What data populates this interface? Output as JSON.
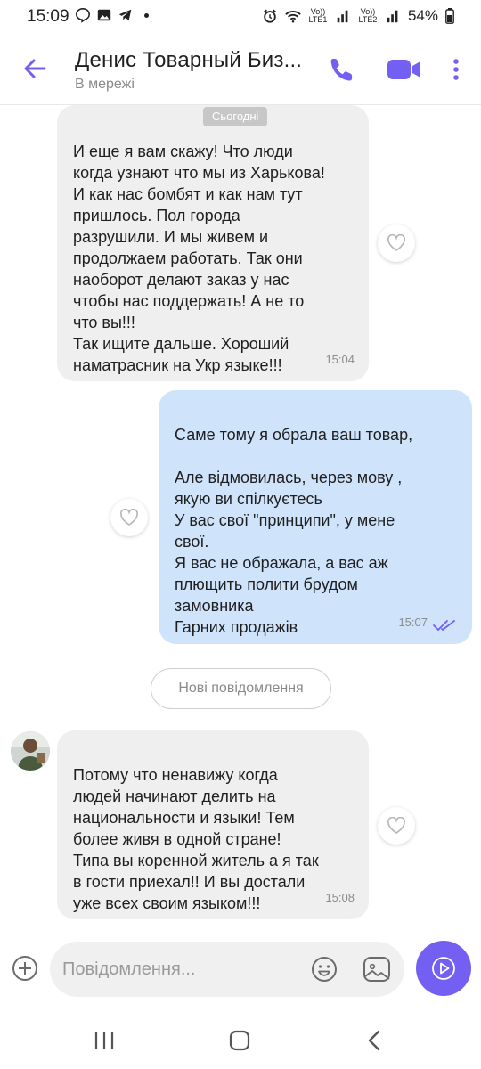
{
  "status_bar": {
    "time": "15:09",
    "lte1": "Vo)) LTE1",
    "lte2": "Vo)) LTE2",
    "battery": "54%"
  },
  "header": {
    "title": "Денис Товарный Биз...",
    "subtitle": "В мережі"
  },
  "chat": {
    "date_divider": "Сьогодні",
    "messages": [
      {
        "direction": "incoming",
        "text": "И еще я вам скажу! Что люди\nкогда узнают что мы из Харькова!\nИ как нас бомбят и как нам тут\nпришлось. Пол города\nразрушили. И мы живем и\nпродолжаем работать. Так они\nнаоборот делают заказ у нас\nчтобы нас поддержать! А не то\nчто вы!!!\nТак ищите дальше. Хороший\nнаматрасник на Укр языке!!!",
        "time": "15:04"
      },
      {
        "direction": "outgoing",
        "text": "Саме тому я обрала ваш товар,\n\nАле  відмовилась, через мову ,\nякую ви спілкуєтесь\nУ вас свої \"принципи\", у мене\nсвої.\nЯ вас не ображала, а вас аж\nплющить  полити брудом\nзамовника\nГарних продажів",
        "time": "15:07",
        "status": "read"
      },
      {
        "direction": "incoming",
        "text": "Потому что ненавижу когда\nлюдей начинают делить на\nнациональности и языки! Тем\nболее живя в одной стране!\nТипа вы коренной житель а я так\nв гости приехал!! И вы достали\nуже всех своим языком!!!",
        "time": "15:08"
      }
    ],
    "new_messages_label": "Нові повідомлення"
  },
  "composer": {
    "placeholder": "Повідомлення..."
  },
  "colors": {
    "accent": "#7360f2",
    "incoming_bubble": "#efefef",
    "outgoing_bubble": "#cfe3fb",
    "read_ticks": "#7360f2"
  },
  "icons": {
    "back": "arrow-left-icon",
    "call": "phone-icon",
    "video": "video-camera-icon",
    "more": "more-vertical-icon",
    "like": "heart-outline-icon",
    "attach": "plus-circle-icon",
    "emoji": "smile-icon",
    "sticker": "sticker-icon",
    "send": "send-icon",
    "read": "double-check-icon"
  }
}
